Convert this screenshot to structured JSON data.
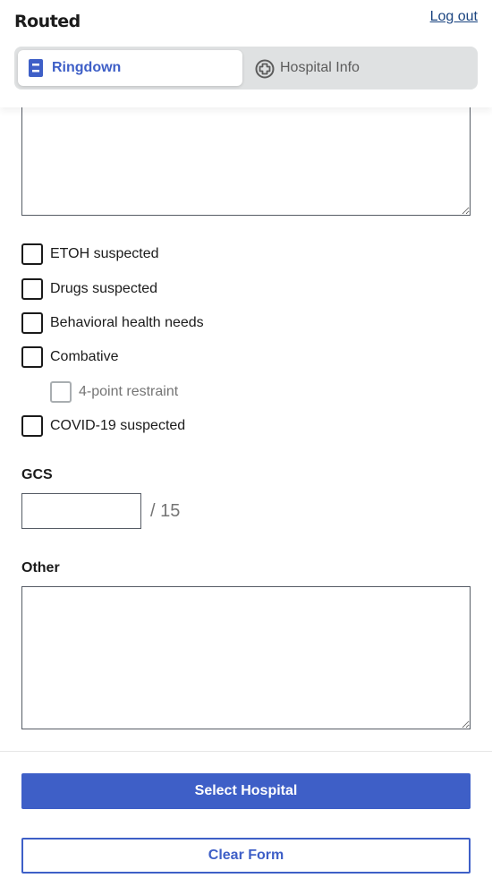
{
  "header": {
    "logo_text": "Routed",
    "logout_label": "Log out"
  },
  "tabs": [
    {
      "label": "Ringdown",
      "icon": "document-icon",
      "active": true
    },
    {
      "label": "Hospital Info",
      "icon": "hospital-plus-icon",
      "active": false
    }
  ],
  "form": {
    "checkboxes": [
      {
        "label": "ETOH suspected",
        "checked": false
      },
      {
        "label": "Drugs suspected",
        "checked": false
      },
      {
        "label": "Behavioral health needs",
        "checked": false
      },
      {
        "label": "Combative",
        "checked": false
      },
      {
        "label": "4-point restraint",
        "checked": false,
        "disabled": true
      },
      {
        "label": "COVID-19 suspected",
        "checked": false
      }
    ],
    "gcs_label": "GCS",
    "gcs_value": "",
    "gcs_suffix": "/ 15",
    "other_label": "Other",
    "other_value": ""
  },
  "footer": {
    "select_hospital_label": "Select Hospital",
    "clear_form_label": "Clear Form"
  },
  "colors": {
    "primary": "#3e5fc7",
    "link": "#1a4480"
  }
}
